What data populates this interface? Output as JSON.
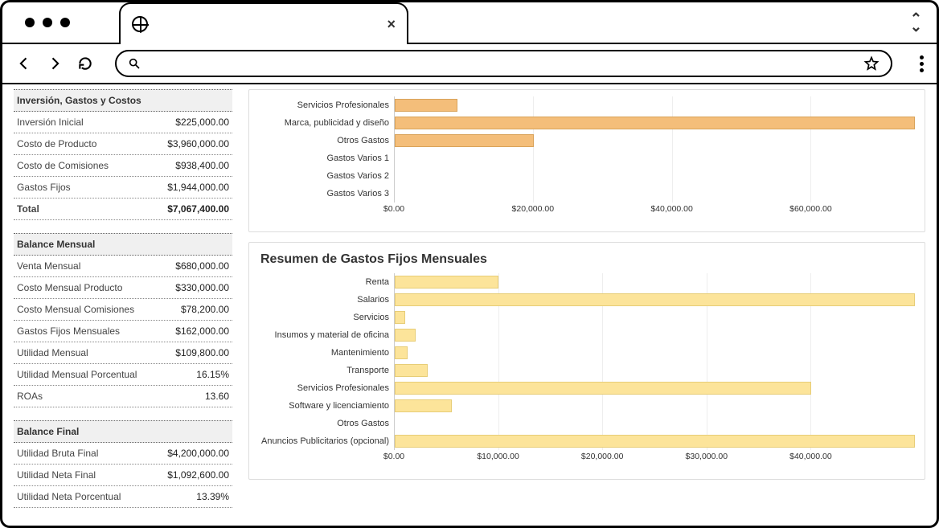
{
  "sidebar": {
    "sections": [
      {
        "title": "Inversión, Gastos y Costos",
        "rows": [
          {
            "label": "Inversión Inicial",
            "value": "$225,000.00"
          },
          {
            "label": "Costo de Producto",
            "value": "$3,960,000.00"
          },
          {
            "label": "Costo de Comisiones",
            "value": "$938,400.00"
          },
          {
            "label": "Gastos Fijos",
            "value": "$1,944,000.00"
          },
          {
            "label": "Total",
            "value": "$7,067,400.00",
            "total": true
          }
        ]
      },
      {
        "title": "Balance Mensual",
        "rows": [
          {
            "label": "Venta Mensual",
            "value": "$680,000.00"
          },
          {
            "label": "Costo Mensual Producto",
            "value": "$330,000.00"
          },
          {
            "label": "Costo Mensual Comisiones",
            "value": "$78,200.00"
          },
          {
            "label": "Gastos Fijos Mensuales",
            "value": "$162,000.00"
          },
          {
            "label": "Utilidad Mensual",
            "value": "$109,800.00"
          },
          {
            "label": "Utilidad Mensual Porcentual",
            "value": "16.15%"
          },
          {
            "label": "ROAs",
            "value": "13.60"
          }
        ]
      },
      {
        "title": "Balance Final",
        "rows": [
          {
            "label": "Utilidad Bruta Final",
            "value": "$4,200,000.00"
          },
          {
            "label": "Utilidad Neta Final",
            "value": "$1,092,600.00"
          },
          {
            "label": "Utilidad Neta Porcentual",
            "value": "13.39%"
          }
        ]
      }
    ]
  },
  "charts": [
    {
      "title": "",
      "color": "orange",
      "max": 75000,
      "ticks": [
        {
          "v": 0,
          "label": "$0.00"
        },
        {
          "v": 20000,
          "label": "$20,000.00"
        },
        {
          "v": 40000,
          "label": "$40,000.00"
        },
        {
          "v": 60000,
          "label": "$60,000.00"
        }
      ],
      "rows": [
        {
          "label": "Servicios Profesionales",
          "value": 9000
        },
        {
          "label": "Marca, publicidad y diseño",
          "value": 75000
        },
        {
          "label": "Otros Gastos",
          "value": 20000
        },
        {
          "label": "Gastos Varios 1",
          "value": 0
        },
        {
          "label": "Gastos Varios 2",
          "value": 0
        },
        {
          "label": "Gastos Varios 3",
          "value": 0
        }
      ]
    },
    {
      "title": "Resumen de Gastos Fijos Mensuales",
      "color": "yellow",
      "max": 50000,
      "ticks": [
        {
          "v": 0,
          "label": "$0.00"
        },
        {
          "v": 10000,
          "label": "$10,000.00"
        },
        {
          "v": 20000,
          "label": "$20,000.00"
        },
        {
          "v": 30000,
          "label": "$30,000.00"
        },
        {
          "v": 40000,
          "label": "$40,000.00"
        }
      ],
      "rows": [
        {
          "label": "Renta",
          "value": 10000
        },
        {
          "label": "Salarios",
          "value": 50000
        },
        {
          "label": "Servicios",
          "value": 1000
        },
        {
          "label": "Insumos y material de oficina",
          "value": 2000
        },
        {
          "label": "Mantenimiento",
          "value": 1200
        },
        {
          "label": "Transporte",
          "value": 3200
        },
        {
          "label": "Servicios Profesionales",
          "value": 40000
        },
        {
          "label": "Software y licenciamiento",
          "value": 5500
        },
        {
          "label": "Otros Gastos",
          "value": 0
        },
        {
          "label": "Anuncios Publicitarios (opcional)",
          "value": 50000
        }
      ]
    }
  ],
  "chart_data": [
    {
      "type": "bar",
      "orientation": "horizontal",
      "title": "",
      "categories": [
        "Servicios Profesionales",
        "Marca, publicidad y diseño",
        "Otros Gastos",
        "Gastos Varios 1",
        "Gastos Varios 2",
        "Gastos Varios 3"
      ],
      "values": [
        9000,
        75000,
        20000,
        0,
        0,
        0
      ],
      "xlabel": "",
      "xlim": [
        0,
        75000
      ],
      "x_ticks": [
        0,
        20000,
        40000,
        60000
      ]
    },
    {
      "type": "bar",
      "orientation": "horizontal",
      "title": "Resumen de Gastos Fijos Mensuales",
      "categories": [
        "Renta",
        "Salarios",
        "Servicios",
        "Insumos y material de oficina",
        "Mantenimiento",
        "Transporte",
        "Servicios Profesionales",
        "Software y licenciamiento",
        "Otros Gastos",
        "Anuncios Publicitarios (opcional)"
      ],
      "values": [
        10000,
        50000,
        1000,
        2000,
        1200,
        3200,
        40000,
        5500,
        0,
        50000
      ],
      "xlabel": "",
      "xlim": [
        0,
        50000
      ],
      "x_ticks": [
        0,
        10000,
        20000,
        30000,
        40000
      ]
    }
  ]
}
